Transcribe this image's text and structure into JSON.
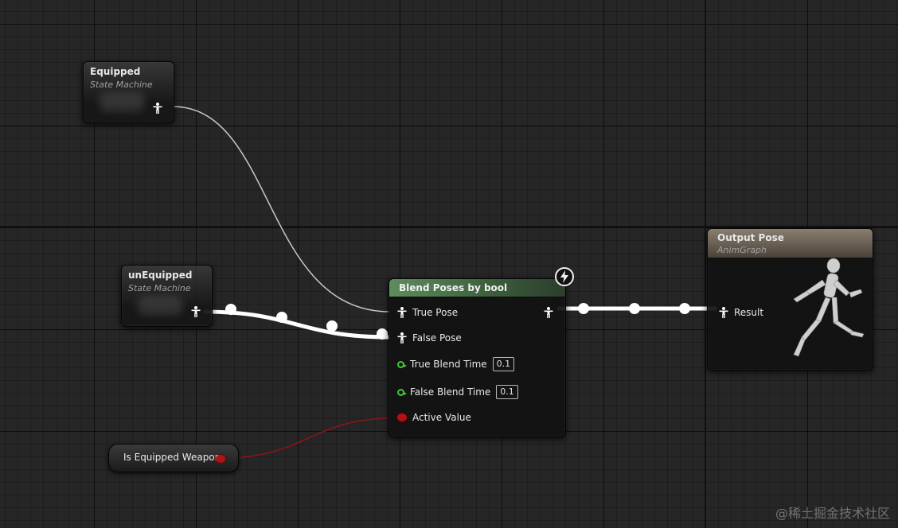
{
  "nodes": {
    "equipped": {
      "title": "Equipped",
      "subtitle": "State Machine"
    },
    "unequipped": {
      "title": "unEquipped",
      "subtitle": "State Machine"
    },
    "blend": {
      "title": "Blend Poses by bool",
      "pins": {
        "true_pose": "True Pose",
        "false_pose": "False Pose",
        "true_blend_time": "True Blend Time",
        "true_blend_value": "0.1",
        "false_blend_time": "False Blend Time",
        "false_blend_value": "0.1",
        "active_value": "Active Value"
      },
      "header_color": "#4a744a"
    },
    "output": {
      "title": "Output Pose",
      "subtitle": "AnimGraph",
      "result": "Result",
      "preview_icon": "running-mannequin-icon"
    },
    "variable": {
      "label": "Is Equipped Weapon",
      "pin_color": "#b31212"
    }
  },
  "icons": {
    "pose_pin": "pose-person-icon",
    "fast_path": "lightning-icon"
  },
  "colors": {
    "pose_wire": "#ffffff",
    "bool_wire": "#8c1515",
    "float_pin": "#3fc93a"
  },
  "watermark": "@稀土掘金技术社区"
}
